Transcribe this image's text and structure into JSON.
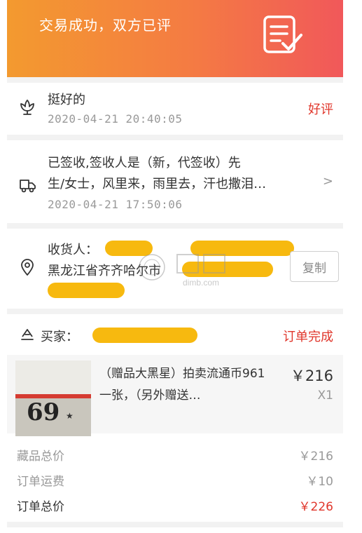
{
  "banner": {
    "title": "交易成功，双方已评",
    "icon": "review-checklist-icon"
  },
  "review": {
    "icon": "flower-icon",
    "text": "挺好的",
    "time": "2020-04-21  20:40:05",
    "rating": "好评"
  },
  "logistics": {
    "icon": "delivery-truck-icon",
    "line1": "已签收,签收人是（新，代签收）先",
    "line2": "生/女士，风里来，雨里去，汗也撒泪…",
    "time": "2020-04-21  17:50:06",
    "chevron": ">"
  },
  "address": {
    "icon": "location-pin-icon",
    "receiver_label": "收货人：",
    "address_text": "黑龙江省齐齐哈尔市",
    "copy_label": "复制"
  },
  "order": {
    "buyer_icon": "user-badge-icon",
    "buyer_label": "买家：",
    "status": "订单完成",
    "product": {
      "name": "（赠品大黑星）拍卖流通币961一张，（另外赠送…",
      "price": "￥216",
      "qty": "X1",
      "thumb_number": "69",
      "thumb_mark": "★"
    },
    "summary": [
      {
        "label": "藏品总价",
        "value": "￥216"
      },
      {
        "label": "订单运费",
        "value": "￥10"
      },
      {
        "label": "订单总价",
        "value": "￥226"
      }
    ]
  },
  "watermark": {
    "text": "dimb.com"
  },
  "colors": {
    "banner_start": "#f39a2f",
    "banner_end": "#f1585a",
    "accent_red": "#e0362b",
    "redaction": "#f7b90f"
  }
}
